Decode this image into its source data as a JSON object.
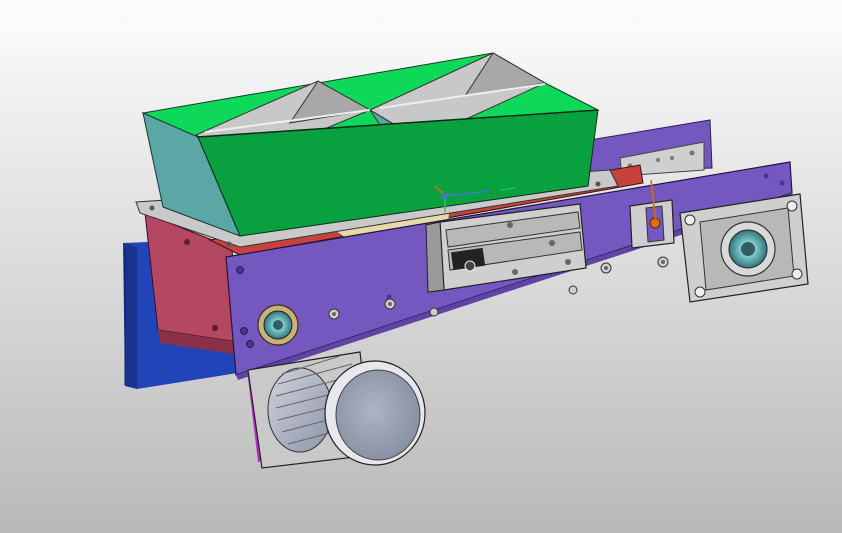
{
  "viewport": {
    "background_top": "#fdfdfd",
    "background_bottom": "#b9b9b9"
  },
  "colors": {
    "frame_purple": "#7558bf",
    "frame_purple_dark": "#5d44a5",
    "side_plate_red": "#b44762",
    "top_plate_red": "#c7423d",
    "side_blue": "#2145b8",
    "hopper_green": "#09a13f",
    "hopper_green_light": "#0ed85a",
    "hopper_teal": "#5aa7a6",
    "hopper_grey": "#c8c8c8",
    "metal_grey": "#c9c9c9",
    "motor_silver": "#9aa2b4",
    "gear_cyan": "#7ec6c7",
    "sensor_orange": "#e06a10",
    "paper_tan": "#e8d9a8",
    "magenta": "#b030c0"
  },
  "components": {
    "hopper": "two-compartment-hopper",
    "main_frame": "main-frame-plate",
    "motor": "drive-motor",
    "bearing_right": "bearing-housing-right",
    "bearing_left": "bearing-housing-left",
    "slide_rail": "linear-slide-rail",
    "sensor": "position-sensor",
    "coordinate_triad": "coordinate-triad-icon"
  }
}
